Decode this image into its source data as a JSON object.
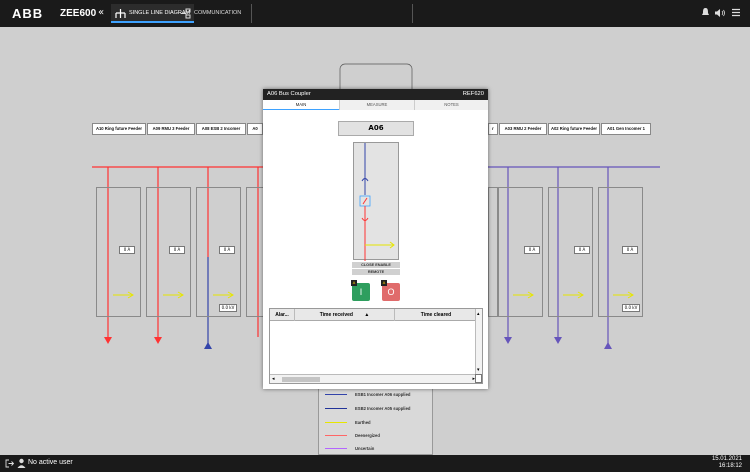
{
  "topbar": {
    "logo": "ABB",
    "product": "ZEE600",
    "collapse_glyph": "«",
    "tabs": [
      {
        "label": "SINGLE LINE DIAGRAM",
        "icon": "single-line-diagram-icon",
        "active": true
      },
      {
        "label": "COMMUNICATION",
        "icon": "communication-icon",
        "active": false
      }
    ],
    "icons": [
      "bell-icon",
      "speaker-icon",
      "menu-icon"
    ]
  },
  "diagram": {
    "feeders_left": [
      "A10 Ring future Feeder",
      "A09 RMU 3 Feeder",
      "A08 ESB 2 Incomer",
      "A0"
    ],
    "feeders_right": [
      "r",
      "A03 RMU 2 Feeder",
      "A02 Ring future Feeder",
      "A01 Gen Incomer 1"
    ],
    "bay_amps": [
      "0 A",
      "0 A",
      "0 A",
      "0 A",
      "0 A",
      "0 A"
    ],
    "bay_kv": [
      "0.0 kV",
      "0.0 kV"
    ]
  },
  "legend": {
    "items": [
      {
        "label": "ESB1 Incomer A06 supplied",
        "color": "#3344aa"
      },
      {
        "label": "ESB2 Incomer A05 supplied",
        "color": "#223399"
      },
      {
        "label": "Earthed",
        "color": "#e6e600"
      },
      {
        "label": "Deenergized",
        "color": "#ff6666"
      },
      {
        "label": "Uncertain",
        "color": "#b366ff"
      }
    ]
  },
  "dialog": {
    "title": "A06 Bus Coupler",
    "model": "REF620",
    "tabs": [
      "MAIN",
      "MEASURE",
      "NOTES"
    ],
    "active_tab": "MAIN",
    "device_name": "A06",
    "close_enable": "CLOSE ENABLE",
    "remote": "REMOTE",
    "close_button": "I",
    "open_button": "O",
    "lock_glyph": "A",
    "alarm_table": {
      "columns": [
        "Alar...",
        "Time received",
        "Time cleared"
      ],
      "sort_glyph": "▲"
    }
  },
  "statusbar": {
    "user": "No active user",
    "date": "15.01.2021",
    "time": "16:18:12"
  },
  "colors": {
    "energized_red": "#ff3333",
    "supplied_blue": "#3333aa",
    "bus_purple": "#6655bb",
    "earthed_yellow": "#e6e600",
    "close_green": "#2e9e5e",
    "open_red": "#e06b6b",
    "accent": "#3ea2ff"
  }
}
